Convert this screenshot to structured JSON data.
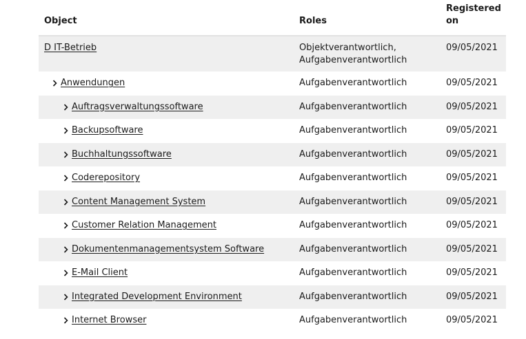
{
  "headers": {
    "object": "Object",
    "roles": "Roles",
    "registered": "Registered on"
  },
  "rows": [
    {
      "object": "D IT-Betrieb",
      "roles": "Objektverantwortlich, Aufgabenverantwortlich",
      "date": "09/05/2021",
      "level": 0
    },
    {
      "object": "Anwendungen",
      "roles": "Aufgabenverantwortlich",
      "date": "09/05/2021",
      "level": 1
    },
    {
      "object": "Auftragsverwaltungssoftware",
      "roles": "Aufgabenverantwortlich",
      "date": "09/05/2021",
      "level": 2
    },
    {
      "object": "Backupsoftware",
      "roles": "Aufgabenverantwortlich",
      "date": "09/05/2021",
      "level": 2
    },
    {
      "object": "Buchhaltungssoftware",
      "roles": "Aufgabenverantwortlich",
      "date": "09/05/2021",
      "level": 2
    },
    {
      "object": "Coderepository",
      "roles": "Aufgabenverantwortlich",
      "date": "09/05/2021",
      "level": 2
    },
    {
      "object": "Content Management System",
      "roles": "Aufgabenverantwortlich",
      "date": "09/05/2021",
      "level": 2
    },
    {
      "object": "Customer Relation Management",
      "roles": "Aufgabenverantwortlich",
      "date": "09/05/2021",
      "level": 2
    },
    {
      "object": "Dokumentenmanagementsystem Software",
      "roles": "Aufgabenverantwortlich",
      "date": "09/05/2021",
      "level": 2
    },
    {
      "object": "E-Mail Client",
      "roles": "Aufgabenverantwortlich",
      "date": "09/05/2021",
      "level": 2
    },
    {
      "object": "Integrated Development Environment",
      "roles": "Aufgabenverantwortlich",
      "date": "09/05/2021",
      "level": 2
    },
    {
      "object": "Internet Browser",
      "roles": "Aufgabenverantwortlich",
      "date": "09/05/2021",
      "level": 2
    }
  ],
  "icons": {
    "expand": "chevron-right-icon"
  },
  "colors": {
    "stripe": "#efefef",
    "text": "#1a1a1a",
    "header_rule": "#e2e2e2"
  }
}
